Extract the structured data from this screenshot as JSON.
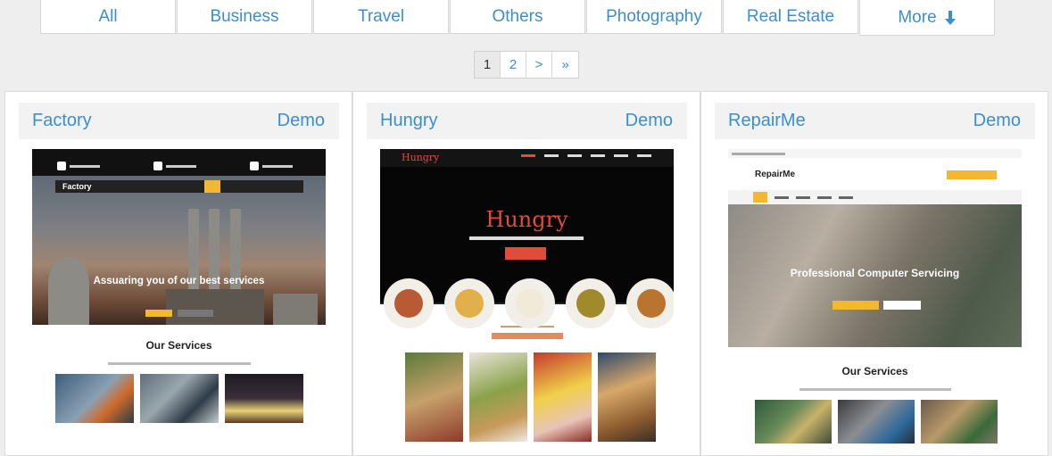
{
  "filters": [
    {
      "label": "All",
      "width": 152
    },
    {
      "label": "Business",
      "width": 152
    },
    {
      "label": "Travel",
      "width": 152
    },
    {
      "label": "Others",
      "width": 152
    },
    {
      "label": "Photography",
      "width": 152
    },
    {
      "label": "Real Estate",
      "width": 152
    },
    {
      "label": "More",
      "width": 152
    }
  ],
  "pagination": [
    "1",
    "2",
    ">",
    "»"
  ],
  "cards": [
    {
      "title": "Factory",
      "demo": "Demo",
      "preview": {
        "hero_text": "Assuaring you of our best services",
        "logo": "Factory",
        "section_title": "Our Services"
      }
    },
    {
      "title": "Hungry",
      "demo": "Demo",
      "preview": {
        "logo": "Hungry",
        "hero_title": "Hungry"
      }
    },
    {
      "title": "RepairMe",
      "demo": "Demo",
      "preview": {
        "logo": "RepairMe",
        "hero_text": "Professional Computer Servicing",
        "section_title": "Our Services"
      }
    }
  ],
  "colors": {
    "accent": "#3a8fd1",
    "yellow": "#f4b731",
    "red": "#e04b3a"
  },
  "icons": {
    "more": "arrow-down-icon"
  }
}
